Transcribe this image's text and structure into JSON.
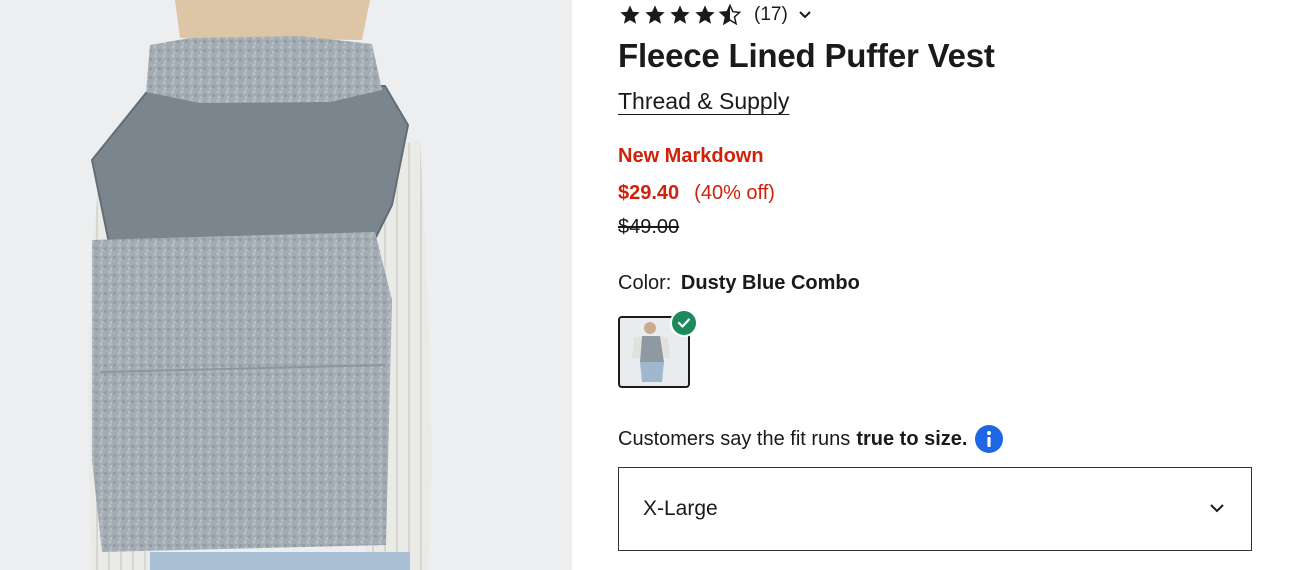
{
  "product": {
    "rating": {
      "stars_filled": 4.5,
      "stars_max": 5,
      "review_count": "(17)"
    },
    "title": "Fleece Lined Puffer Vest",
    "brand": "Thread & Supply",
    "markdown_label": "New Markdown",
    "sale_price": "$29.40",
    "discount": "(40% off)",
    "original_price": "$49.00",
    "color_label": "Color:",
    "color_value": "Dusty Blue Combo",
    "fit_text": "Customers say the fit runs",
    "fit_value": "true to size.",
    "size_selected": "X-Large"
  },
  "colors": {
    "sale": "#d0210a",
    "text": "#1a1a1a",
    "check_badge": "#1e8a5b",
    "info_icon": "#1f66e5"
  },
  "icons": {
    "rating_dropdown": "chevron-down-icon",
    "swatch_selected": "check-icon",
    "fit_info": "info-icon",
    "size_dropdown": "chevron-down-icon"
  }
}
